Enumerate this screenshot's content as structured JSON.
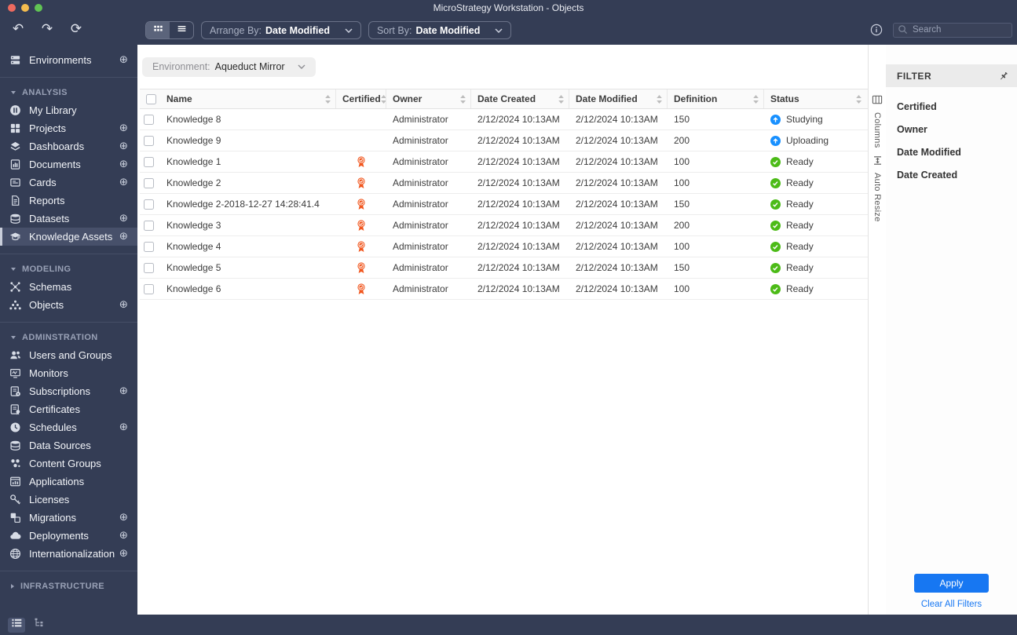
{
  "window": {
    "title": "MicroStrategy Workstation - Objects"
  },
  "toolbar": {
    "arrange_by_label": "Arrange By:",
    "arrange_by_value": "Date Modified",
    "sort_by_label": "Sort By:",
    "sort_by_value": "Date Modified",
    "search_placeholder": "Search"
  },
  "environment_bar": {
    "label": "Environment:",
    "value": "Aqueduct Mirror"
  },
  "sidebar": {
    "groups": [
      {
        "items": [
          {
            "label": "Environments",
            "icon": "environments",
            "add": true
          }
        ]
      },
      {
        "section": "ANALYSIS",
        "items": [
          {
            "label": "My Library",
            "icon": "my-library"
          },
          {
            "label": "Projects",
            "icon": "projects",
            "add": true
          },
          {
            "label": "Dashboards",
            "icon": "dashboards",
            "add": true
          },
          {
            "label": "Documents",
            "icon": "documents",
            "add": true
          },
          {
            "label": "Cards",
            "icon": "cards",
            "add": true
          },
          {
            "label": "Reports",
            "icon": "reports"
          },
          {
            "label": "Datasets",
            "icon": "datasets",
            "add": true
          },
          {
            "label": "Knowledge Assets",
            "icon": "knowledge-assets",
            "add": true,
            "selected": true
          }
        ]
      },
      {
        "section": "MODELING",
        "items": [
          {
            "label": "Schemas",
            "icon": "schemas"
          },
          {
            "label": "Objects",
            "icon": "objects",
            "add": true
          }
        ]
      },
      {
        "section": "ADMINSTRATION",
        "items": [
          {
            "label": "Users and Groups",
            "icon": "users-groups"
          },
          {
            "label": "Monitors",
            "icon": "monitors"
          },
          {
            "label": "Subscriptions",
            "icon": "subscriptions",
            "add": true
          },
          {
            "label": "Certificates",
            "icon": "certificates"
          },
          {
            "label": "Schedules",
            "icon": "schedules",
            "add": true
          },
          {
            "label": "Data Sources",
            "icon": "data-sources"
          },
          {
            "label": "Content Groups",
            "icon": "content-groups"
          },
          {
            "label": "Applications",
            "icon": "applications"
          },
          {
            "label": "Licenses",
            "icon": "licenses"
          },
          {
            "label": "Migrations",
            "icon": "migrations",
            "add": true
          },
          {
            "label": "Deployments",
            "icon": "deployments",
            "add": true
          },
          {
            "label": "Internationalization",
            "icon": "internationalization",
            "add": true
          }
        ]
      },
      {
        "section": "INFRASTRUCTURE",
        "collapsed": true,
        "items": []
      }
    ]
  },
  "table": {
    "columns": [
      {
        "key": "name",
        "label": "Name"
      },
      {
        "key": "certified",
        "label": "Certified"
      },
      {
        "key": "owner",
        "label": "Owner"
      },
      {
        "key": "date_created",
        "label": "Date Created"
      },
      {
        "key": "date_modified",
        "label": "Date Modified"
      },
      {
        "key": "definition",
        "label": "Definition"
      },
      {
        "key": "status",
        "label": "Status"
      }
    ],
    "rows": [
      {
        "name": "Knowledge 8",
        "certified": false,
        "owner": "Administrator",
        "date_created": "2/12/2024 10:13AM",
        "date_modified": "2/12/2024 10:13AM",
        "definition": "150",
        "status": "Studying",
        "status_icon": "up-circle"
      },
      {
        "name": "Knowledge 9",
        "certified": false,
        "owner": "Administrator",
        "date_created": "2/12/2024 10:13AM",
        "date_modified": "2/12/2024 10:13AM",
        "definition": "200",
        "status": "Uploading",
        "status_icon": "up-circle"
      },
      {
        "name": "Knowledge 1",
        "certified": true,
        "owner": "Administrator",
        "date_created": "2/12/2024 10:13AM",
        "date_modified": "2/12/2024 10:13AM",
        "definition": "100",
        "status": "Ready",
        "status_icon": "check-circle"
      },
      {
        "name": "Knowledge 2",
        "certified": true,
        "owner": "Administrator",
        "date_created": "2/12/2024 10:13AM",
        "date_modified": "2/12/2024 10:13AM",
        "definition": "100",
        "status": "Ready",
        "status_icon": "check-circle"
      },
      {
        "name": "Knowledge 2-2018-12-27 14:28:41.4",
        "certified": true,
        "owner": "Administrator",
        "date_created": "2/12/2024 10:13AM",
        "date_modified": "2/12/2024 10:13AM",
        "definition": "150",
        "status": "Ready",
        "status_icon": "check-circle"
      },
      {
        "name": "Knowledge 3",
        "certified": true,
        "owner": "Administrator",
        "date_created": "2/12/2024 10:13AM",
        "date_modified": "2/12/2024 10:13AM",
        "definition": "200",
        "status": "Ready",
        "status_icon": "check-circle"
      },
      {
        "name": "Knowledge 4",
        "certified": true,
        "owner": "Administrator",
        "date_created": "2/12/2024 10:13AM",
        "date_modified": "2/12/2024 10:13AM",
        "definition": "100",
        "status": "Ready",
        "status_icon": "check-circle"
      },
      {
        "name": "Knowledge 5",
        "certified": true,
        "owner": "Administrator",
        "date_created": "2/12/2024 10:13AM",
        "date_modified": "2/12/2024 10:13AM",
        "definition": "150",
        "status": "Ready",
        "status_icon": "check-circle"
      },
      {
        "name": "Knowledge 6",
        "certified": true,
        "owner": "Administrator",
        "date_created": "2/12/2024 10:13AM",
        "date_modified": "2/12/2024 10:13AM",
        "definition": "100",
        "status": "Ready",
        "status_icon": "check-circle"
      }
    ]
  },
  "table_tools": {
    "columns_label": "Columns",
    "auto_resize_label": "Auto Resize"
  },
  "filter_panel": {
    "title": "FILTER",
    "items": [
      "Certified",
      "Owner",
      "Date Modified",
      "Date Created"
    ],
    "apply_label": "Apply",
    "clear_label": "Clear All Filters"
  },
  "colors": {
    "accent_blue": "#1777F2",
    "status_ready_green": "#4CBB17",
    "status_progress_blue": "#1890FF",
    "certified_orange": "#F1561E",
    "chrome_navy": "#343D55",
    "traffic_red": "#EE6A5F",
    "traffic_yellow": "#F5BD4F",
    "traffic_green": "#61C454"
  }
}
